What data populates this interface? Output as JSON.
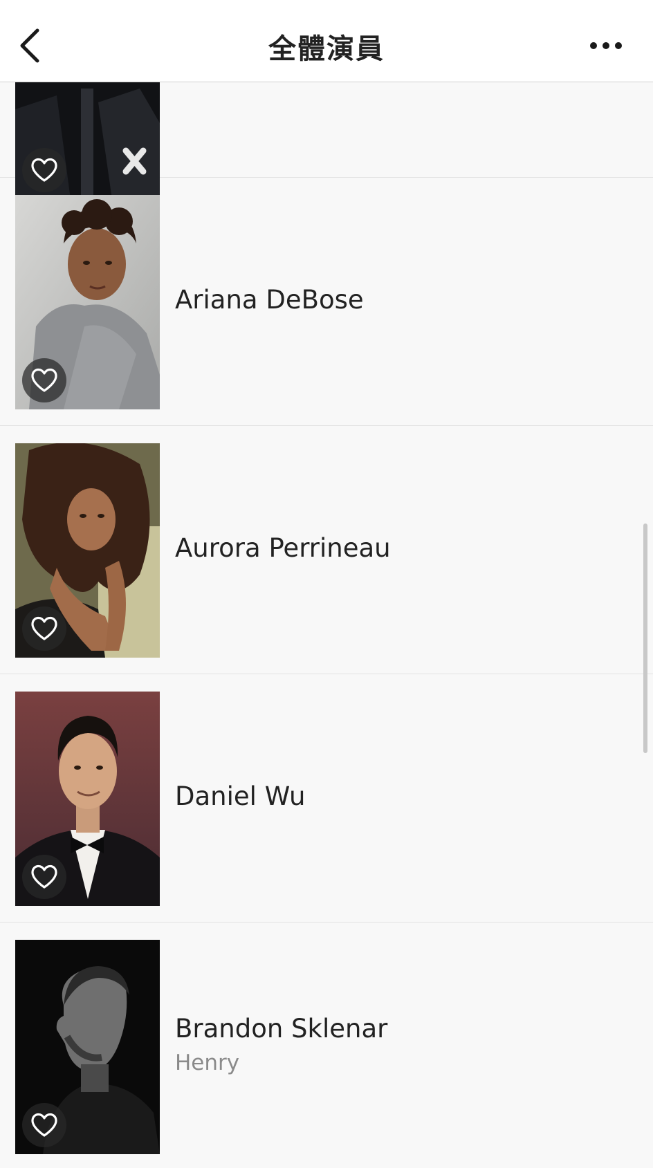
{
  "navbar": {
    "title": "全體演員",
    "back_icon": "chevron-left-icon",
    "more_icon": "more-dots-icon"
  },
  "cast": [
    {
      "name": "",
      "role": "",
      "favorite_icon": "heart-outline-icon"
    },
    {
      "name": "Ariana DeBose",
      "role": "",
      "favorite_icon": "heart-outline-icon"
    },
    {
      "name": "Aurora Perrineau",
      "role": "",
      "favorite_icon": "heart-outline-icon"
    },
    {
      "name": "Daniel Wu",
      "role": "",
      "favorite_icon": "heart-outline-icon"
    },
    {
      "name": "Brandon Sklenar",
      "role": "Henry",
      "favorite_icon": "heart-outline-icon"
    }
  ],
  "colors": {
    "background": "#f8f8f8",
    "navbar": "#ffffff",
    "text_primary": "#222222",
    "text_secondary": "#8a8a8a",
    "divider": "#e2e2e2"
  }
}
